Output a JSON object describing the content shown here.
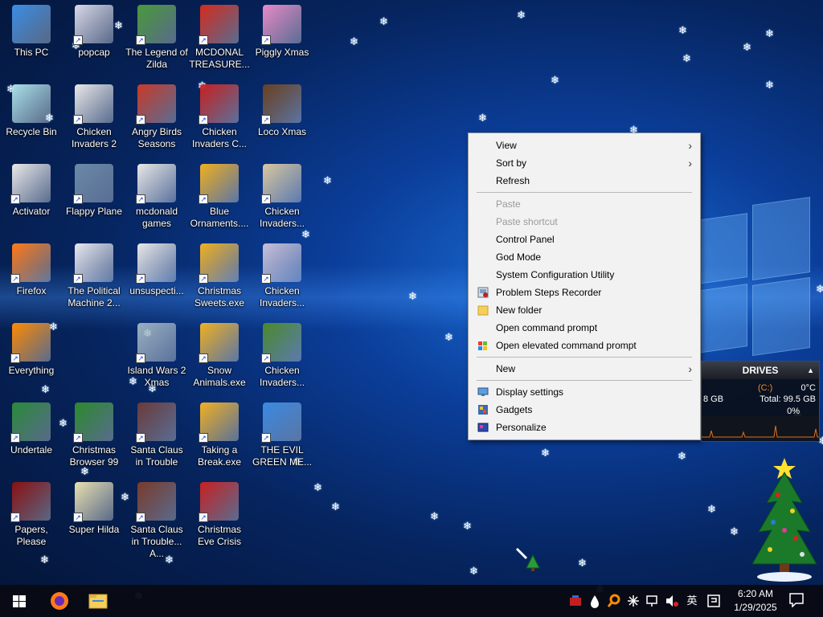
{
  "desktop": {
    "icons": [
      {
        "label": "This PC",
        "color": "#3a8ee6"
      },
      {
        "label": "popcap",
        "color": "#d8d8e8"
      },
      {
        "label": "The Legend of Zilda",
        "color": "#4a9a3a"
      },
      {
        "label": "MCDONAL TREASURE...",
        "color": "#d52b1e"
      },
      {
        "label": "Piggly Xmas",
        "color": "#e88ac8"
      },
      {
        "label": "Recycle Bin",
        "color": "#a8e0e8"
      },
      {
        "label": "Chicken Invaders 2",
        "color": "#e8e8e8"
      },
      {
        "label": "Angry Birds Seasons",
        "color": "#c83a2a"
      },
      {
        "label": "Chicken Invaders C...",
        "color": "#c82020"
      },
      {
        "label": "Loco Xmas",
        "color": "#6a4020"
      },
      {
        "label": "Activator",
        "color": "#e8e8e8"
      },
      {
        "label": "Flappy Plane",
        "color": "#6a8aa8"
      },
      {
        "label": "mcdonald games",
        "color": "#e8e8e8"
      },
      {
        "label": "Blue Ornaments....",
        "color": "#f0b020"
      },
      {
        "label": "Chicken Invaders...",
        "color": "#d8c8a0"
      },
      {
        "label": "Firefox",
        "color": "#ff7a18"
      },
      {
        "label": "The Political Machine 2...",
        "color": "#e8e8f0"
      },
      {
        "label": "unsuspecti...",
        "color": "#e8e8e8"
      },
      {
        "label": "Christmas Sweets.exe",
        "color": "#f0b020"
      },
      {
        "label": "Chicken Invaders...",
        "color": "#c8c0d8"
      },
      {
        "label": "Everything",
        "color": "#ff8a00"
      },
      {
        "label": "Island Wars 2 Xmas",
        "color": "#9ab0c0"
      },
      {
        "label": "Snow Animals.exe",
        "color": "#f0b020"
      },
      {
        "label": "Chicken Invaders...",
        "color": "#4a8a2a"
      },
      {
        "label": "Undertale",
        "color": "#2a8a3a"
      },
      {
        "label": "Christmas Browser 99",
        "color": "#2a8a2a"
      },
      {
        "label": "Santa Claus in Trouble",
        "color": "#6a3a3a"
      },
      {
        "label": "Taking a Break.exe",
        "color": "#f0b020"
      },
      {
        "label": "THE EVIL GREEN ME...",
        "color": "#3a8ae0"
      },
      {
        "label": "Papers, Please",
        "color": "#8a1010"
      },
      {
        "label": "Super Hilda",
        "color": "#e8e0b0"
      },
      {
        "label": "Santa Claus in Trouble... A...",
        "color": "#7a3a2a"
      },
      {
        "label": "Christmas Eve Crisis",
        "color": "#c82020"
      }
    ]
  },
  "context_menu": {
    "view": "View",
    "sort_by": "Sort by",
    "refresh": "Refresh",
    "paste": "Paste",
    "paste_shortcut": "Paste shortcut",
    "control_panel": "Control Panel",
    "god_mode": "God Mode",
    "system_configuration_utility": "System Configuration Utility",
    "problem_steps_recorder": "Problem Steps Recorder",
    "new_folder": "New folder",
    "open_command_prompt": "Open command prompt",
    "open_elevated_command_prompt": "Open elevated command prompt",
    "new": "New",
    "display_settings": "Display settings",
    "gadgets": "Gadgets",
    "personalize": "Personalize"
  },
  "drives_gadget": {
    "title": "DRIVES",
    "drive": "(C:)",
    "temp": "0°C",
    "used": "8 GB",
    "total": "Total: 99.5 GB",
    "percent": "0%"
  },
  "taskbar": {
    "time": "6:20 AM",
    "date": "1/29/2025",
    "ime": "英"
  },
  "colors": {
    "accent": "#0b3e9a",
    "menu_bg": "#f2f2f2",
    "taskbar_bg": "#080a14"
  }
}
